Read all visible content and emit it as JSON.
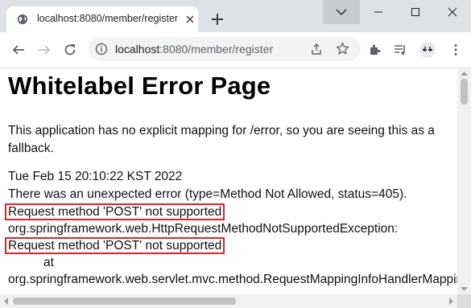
{
  "tab": {
    "title": "localhost:8080/member/register"
  },
  "omnibox": {
    "host": "localhost",
    "rest": ":8080/member/register"
  },
  "page": {
    "heading": "Whitelabel Error Page",
    "intro": "This application has no explicit mapping for /error, so you are seeing this as a fallback.",
    "timestamp": "Tue Feb 15 20:10:22 KST 2022",
    "error_line": "There was an unexpected error (type=Method Not Allowed, status=405).",
    "message_1": "Request method 'POST' not supported",
    "exception": "org.springframework.web.HttpRequestMethodNotSupportedException:",
    "message_2": "Request method 'POST' not supported",
    "at": "at",
    "trace": "org.springframework.web.servlet.mvc.method.RequestMappingInfoHandlerMapping"
  },
  "colors": {
    "highlight_box": "#d9252a",
    "chrome_bg": "#dee1e6"
  }
}
